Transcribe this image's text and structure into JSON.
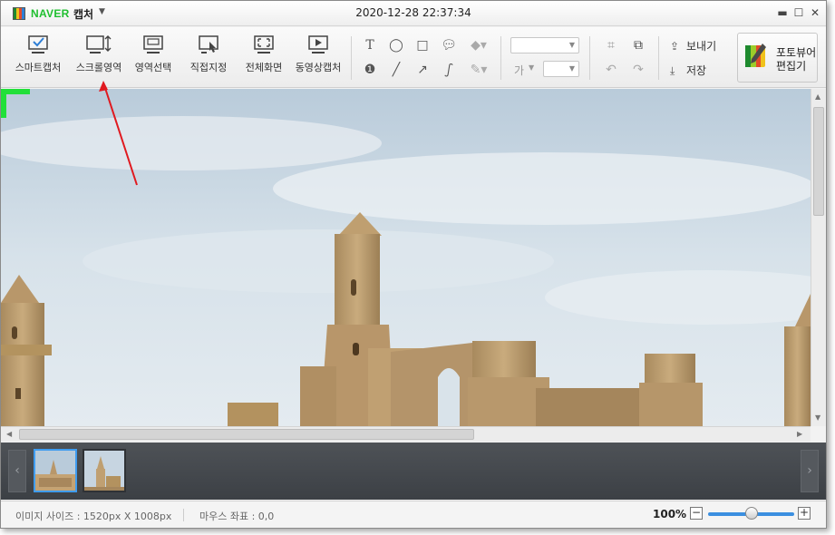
{
  "titlebar": {
    "brand": "NAVER",
    "app_name": "캡처",
    "datetime": "2020-12-28 22:37:34"
  },
  "toolbar": {
    "capture_modes": [
      {
        "label": "스마트캡처",
        "icon": "smart-capture-icon"
      },
      {
        "label": "스크롤영역",
        "icon": "scroll-capture-icon"
      },
      {
        "label": "영역선택",
        "icon": "region-select-icon"
      },
      {
        "label": "직접지정",
        "icon": "direct-select-icon"
      },
      {
        "label": "전체화면",
        "icon": "fullscreen-icon"
      },
      {
        "label": "동영상캡처",
        "icon": "video-capture-icon"
      }
    ],
    "font_size_label": "가",
    "send_label": "보내기",
    "save_label": "저장",
    "photo_editor_line1": "포토뷰어",
    "photo_editor_line2": "편집기"
  },
  "status": {
    "image_size": "이미지 사이즈 : 1520px X 1008px",
    "mouse_coords": "마우스 좌표 : 0,0",
    "zoom": "100%",
    "zoom_level": 0.5
  },
  "colors": {
    "brand_green": "#1fbf2f",
    "selection_blue": "#3f9cf0",
    "annotation_arrow": "#e0191f"
  }
}
